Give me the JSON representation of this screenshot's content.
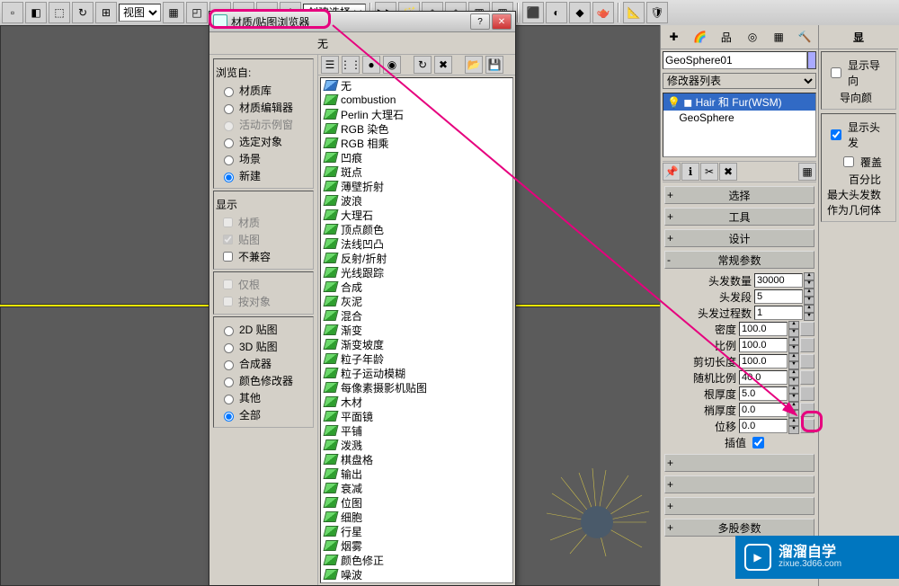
{
  "toolbar": {
    "view_select": "视图",
    "create_select": "创建选择集"
  },
  "dialog": {
    "title": "材质/贴图浏览器",
    "sample_label": "无",
    "browse_from_label": "浏览自:",
    "browse_from": [
      {
        "label": "材质库",
        "enabled": true
      },
      {
        "label": "材质编辑器",
        "enabled": true
      },
      {
        "label": "活动示例窗",
        "enabled": false
      },
      {
        "label": "选定对象",
        "enabled": true
      },
      {
        "label": "场景",
        "enabled": true
      },
      {
        "label": "新建",
        "enabled": true,
        "checked": true
      }
    ],
    "display_label": "显示",
    "display": [
      {
        "label": "材质",
        "enabled": false
      },
      {
        "label": "贴图",
        "enabled": false,
        "checked": true
      },
      {
        "label": "不兼容",
        "enabled": true
      }
    ],
    "root": [
      {
        "label": "仅根",
        "enabled": false
      },
      {
        "label": "按对象",
        "enabled": false
      }
    ],
    "type": [
      {
        "label": "2D 贴图"
      },
      {
        "label": "3D 贴图"
      },
      {
        "label": "合成器"
      },
      {
        "label": "颜色修改器"
      },
      {
        "label": "其他"
      },
      {
        "label": "全部",
        "checked": true
      }
    ],
    "maps": [
      "无",
      "combustion",
      "Perlin 大理石",
      "RGB 染色",
      "RGB 相乘",
      "凹痕",
      "斑点",
      "薄壁折射",
      "波浪",
      "大理石",
      "顶点颜色",
      "法线凹凸",
      "反射/折射",
      "光线跟踪",
      "合成",
      "灰泥",
      "混合",
      "渐变",
      "渐变坡度",
      "粒子年龄",
      "粒子运动模糊",
      "每像素摄影机贴图",
      "木材",
      "平面镜",
      "平铺",
      "泼溅",
      "棋盘格",
      "输出",
      "衰减",
      "位图",
      "细胞",
      "行星",
      "烟雾",
      "颜色修正",
      "噪波"
    ]
  },
  "panel": {
    "object_name": "GeoSphere01",
    "modifier_list": "修改器列表",
    "stack": [
      {
        "label": "Hair 和 Fur(WSM)",
        "selected": true,
        "bulb": true
      },
      {
        "label": "GeoSphere"
      }
    ],
    "rollouts": {
      "select": "选择",
      "tools": "工具",
      "design": "设计",
      "general": "常规参数",
      "multi": "多股参数"
    },
    "params": {
      "hair_count": {
        "label": "头发数量",
        "value": "30000"
      },
      "hair_seg": {
        "label": "头发段",
        "value": "5"
      },
      "hair_pass": {
        "label": "头发过程数",
        "value": "1"
      },
      "density": {
        "label": "密度",
        "value": "100.0"
      },
      "scale": {
        "label": "比例",
        "value": "100.0"
      },
      "cut": {
        "label": "剪切长度",
        "value": "100.0"
      },
      "rand": {
        "label": "随机比例",
        "value": "40.0"
      },
      "root": {
        "label": "根厚度",
        "value": "5.0"
      },
      "tip": {
        "label": "梢厚度",
        "value": "0.0"
      },
      "offset": {
        "label": "位移",
        "value": "0.0"
      },
      "interp": {
        "label": "插值"
      }
    },
    "side": {
      "xian": "显",
      "show_guide": "显示导向",
      "guide_color": "导向颜",
      "show_hair": "显示头发",
      "override": "覆盖",
      "percent": "百分比",
      "max_hair": "最大头发数",
      "as_geo": "作为几何体"
    }
  },
  "watermark": {
    "brand": "溜溜自学",
    "url": "zixue.3d66.com"
  }
}
